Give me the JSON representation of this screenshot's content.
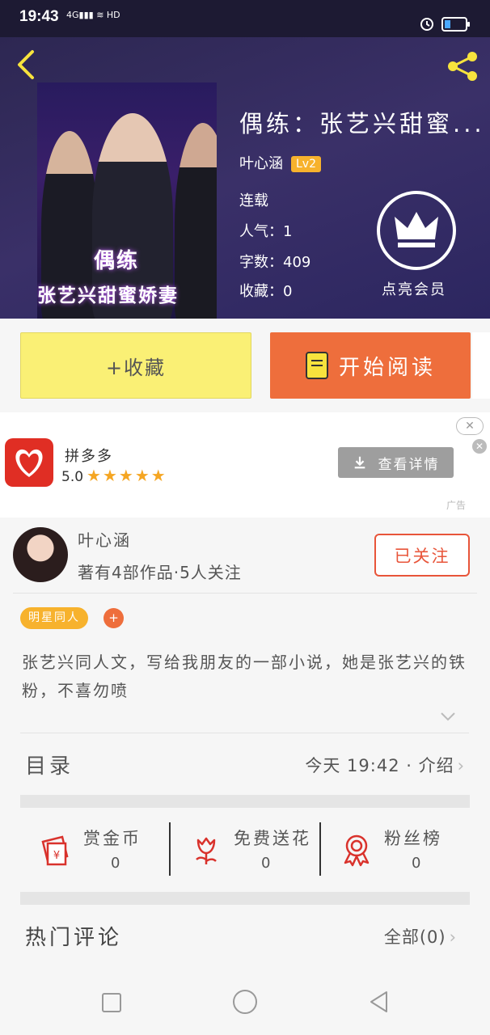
{
  "status": {
    "time": "19:43",
    "network": "4G",
    "wifi_hd": "HD"
  },
  "book": {
    "title": "偶练：张艺兴甜蜜...",
    "author": "叶心涵",
    "level": "Lv2",
    "status": "连载",
    "popularity": "人气：1",
    "word_count": "字数：409",
    "favorites": "收藏：0",
    "cover_text_1": "偶练",
    "cover_text_2": "张艺兴甜蜜娇妻"
  },
  "vip": {
    "label": "点亮会员"
  },
  "actions": {
    "favorite": "+收藏",
    "read": "开始阅读"
  },
  "ad": {
    "app_name": "拼多多",
    "rating": "5.0",
    "stars": "★★★★★",
    "detail_button": "查看详情",
    "close": "✕",
    "tag": "广告"
  },
  "author_card": {
    "name": "叶心涵",
    "stats": "著有4部作品·5人关注",
    "follow_button": "已关注"
  },
  "tags": {
    "category": "明星同人",
    "add": "+"
  },
  "synopsis": "张艺兴同人文，写给我朋友的一部小说，她是张艺兴的铁粉，不喜勿喷",
  "toc": {
    "label": "目录",
    "update": "今天 19:42 · 介绍"
  },
  "stats": [
    {
      "label": "赏金币",
      "value": "0",
      "icon": "red-envelope-icon"
    },
    {
      "label": "免费送花",
      "value": "0",
      "icon": "flower-icon"
    },
    {
      "label": "粉丝榜",
      "value": "0",
      "icon": "medal-icon"
    }
  ],
  "comments": {
    "label": "热门评论",
    "all": "全部(0)"
  },
  "colors": {
    "orange": "#ee6e3c",
    "yellow_btn": "#faf075",
    "tag": "#f7b22d",
    "hero_bg": "#2d2752"
  }
}
